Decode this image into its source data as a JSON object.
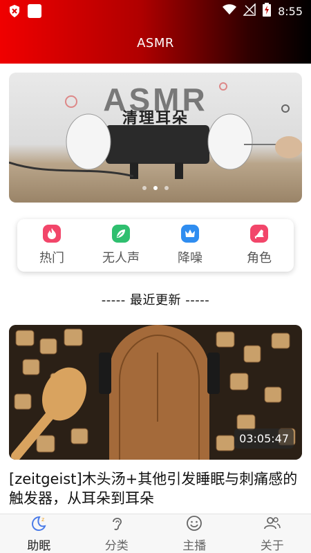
{
  "status_bar": {
    "time": "8:55",
    "icons": [
      "shield-icon",
      "app-square-icon",
      "wifi-icon",
      "signal-icon",
      "battery-charging-icon"
    ]
  },
  "app_bar": {
    "title": "ASMR"
  },
  "banner": {
    "title": "ASMR",
    "subtitle": "清理耳朵",
    "page_count": 3,
    "active_index": 1
  },
  "categories": [
    {
      "label": "热门",
      "icon": "fire-icon",
      "color": "#f2466a"
    },
    {
      "label": "无人声",
      "icon": "leaf-icon",
      "color": "#2fbf6f"
    },
    {
      "label": "降噪",
      "icon": "crown-icon",
      "color": "#2f8df0"
    },
    {
      "label": "角色",
      "icon": "heel-icon",
      "color": "#f2466a"
    }
  ],
  "section": {
    "heading": "-----  最近更新  -----"
  },
  "video": {
    "duration": "03:05:47",
    "title": "[zeitgeist]木头汤+其他引发睡眠与刺痛感的触发器，从耳朵到耳朵"
  },
  "bottom_nav": [
    {
      "label": "助眠",
      "icon": "moon-icon",
      "active": true
    },
    {
      "label": "分类",
      "icon": "ear-icon",
      "active": false
    },
    {
      "label": "主播",
      "icon": "smile-icon",
      "active": false
    },
    {
      "label": "关于",
      "icon": "people-icon",
      "active": false
    }
  ],
  "colors": {
    "header_gradient_start": "#f00000",
    "header_gradient_end": "#000000",
    "nav_active": "#4a7be8"
  }
}
